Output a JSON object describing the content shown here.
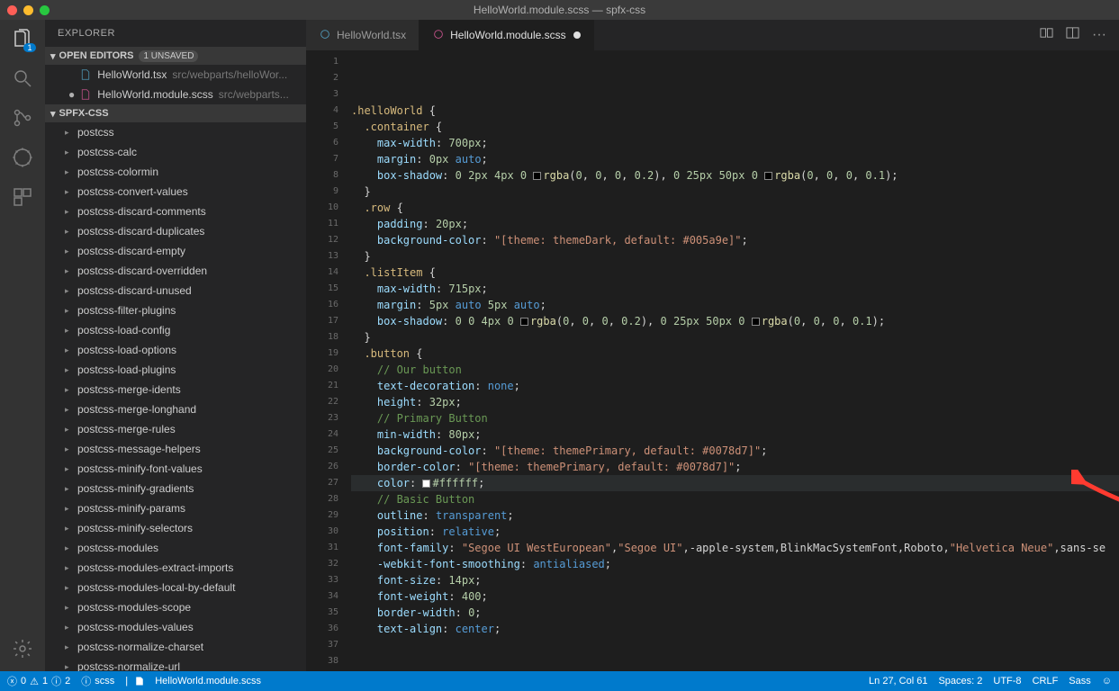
{
  "titlebar": {
    "title": "HelloWorld.module.scss — spfx-css"
  },
  "activity": {
    "badge": "1"
  },
  "sidebar": {
    "header": "EXPLORER",
    "open_editors": {
      "label": "OPEN EDITORS",
      "unsaved": "1 UNSAVED"
    },
    "files": [
      {
        "name": "HelloWorld.tsx",
        "path": "src/webparts/helloWor..."
      },
      {
        "name": "HelloWorld.module.scss",
        "path": "src/webparts..."
      }
    ],
    "project": "SPFX-CSS",
    "tree": [
      "postcss",
      "postcss-calc",
      "postcss-colormin",
      "postcss-convert-values",
      "postcss-discard-comments",
      "postcss-discard-duplicates",
      "postcss-discard-empty",
      "postcss-discard-overridden",
      "postcss-discard-unused",
      "postcss-filter-plugins",
      "postcss-load-config",
      "postcss-load-options",
      "postcss-load-plugins",
      "postcss-merge-idents",
      "postcss-merge-longhand",
      "postcss-merge-rules",
      "postcss-message-helpers",
      "postcss-minify-font-values",
      "postcss-minify-gradients",
      "postcss-minify-params",
      "postcss-minify-selectors",
      "postcss-modules",
      "postcss-modules-extract-imports",
      "postcss-modules-local-by-default",
      "postcss-modules-scope",
      "postcss-modules-values",
      "postcss-normalize-charset",
      "postcss-normalize-url"
    ]
  },
  "tabs": [
    {
      "name": "HelloWorld.tsx",
      "modified": false
    },
    {
      "name": "HelloWorld.module.scss",
      "modified": true
    }
  ],
  "status": {
    "errors": "0",
    "warnings_a": "1",
    "warnings_i": "2",
    "lang_status": "scss",
    "filename": "HelloWorld.module.scss",
    "pos": "Ln 27, Col 61",
    "spaces": "Spaces: 2",
    "enc": "UTF-8",
    "eol": "CRLF",
    "lang": "Sass"
  },
  "code": {
    "lines": [
      [
        {
          "c": "t-sel",
          "t": ".helloWorld"
        },
        {
          "t": " {"
        }
      ],
      [
        {
          "t": "  "
        },
        {
          "c": "t-sel",
          "t": ".container"
        },
        {
          "t": " {"
        }
      ],
      [
        {
          "t": "    "
        },
        {
          "c": "t-prop",
          "t": "max-width"
        },
        {
          "t": ": "
        },
        {
          "c": "t-num",
          "t": "700px"
        },
        {
          "t": ";"
        }
      ],
      [
        {
          "t": "    "
        },
        {
          "c": "t-prop",
          "t": "margin"
        },
        {
          "t": ": "
        },
        {
          "c": "t-num",
          "t": "0px"
        },
        {
          "t": " "
        },
        {
          "c": "t-key",
          "t": "auto"
        },
        {
          "t": ";"
        }
      ],
      [
        {
          "t": "    "
        },
        {
          "c": "t-prop",
          "t": "box-shadow"
        },
        {
          "t": ": "
        },
        {
          "c": "t-num",
          "t": "0"
        },
        {
          "t": " "
        },
        {
          "c": "t-num",
          "t": "2px"
        },
        {
          "t": " "
        },
        {
          "c": "t-num",
          "t": "4px"
        },
        {
          "t": " "
        },
        {
          "c": "t-num",
          "t": "0"
        },
        {
          "t": " "
        },
        {
          "box": "#000"
        },
        {
          "c": "t-fn",
          "t": "rgba"
        },
        {
          "t": "("
        },
        {
          "c": "t-num",
          "t": "0"
        },
        {
          "t": ", "
        },
        {
          "c": "t-num",
          "t": "0"
        },
        {
          "t": ", "
        },
        {
          "c": "t-num",
          "t": "0"
        },
        {
          "t": ", "
        },
        {
          "c": "t-num",
          "t": "0.2"
        },
        {
          "t": "), "
        },
        {
          "c": "t-num",
          "t": "0"
        },
        {
          "t": " "
        },
        {
          "c": "t-num",
          "t": "25px"
        },
        {
          "t": " "
        },
        {
          "c": "t-num",
          "t": "50px"
        },
        {
          "t": " "
        },
        {
          "c": "t-num",
          "t": "0"
        },
        {
          "t": " "
        },
        {
          "box": "#000"
        },
        {
          "c": "t-fn",
          "t": "rgba"
        },
        {
          "t": "("
        },
        {
          "c": "t-num",
          "t": "0"
        },
        {
          "t": ", "
        },
        {
          "c": "t-num",
          "t": "0"
        },
        {
          "t": ", "
        },
        {
          "c": "t-num",
          "t": "0"
        },
        {
          "t": ", "
        },
        {
          "c": "t-num",
          "t": "0.1"
        },
        {
          "t": ");"
        }
      ],
      [
        {
          "t": "  }"
        }
      ],
      [
        {
          "t": ""
        }
      ],
      [
        {
          "t": "  "
        },
        {
          "c": "t-sel",
          "t": ".row"
        },
        {
          "t": " {"
        }
      ],
      [
        {
          "t": "    "
        },
        {
          "c": "t-prop",
          "t": "padding"
        },
        {
          "t": ": "
        },
        {
          "c": "t-num",
          "t": "20px"
        },
        {
          "t": ";"
        }
      ],
      [
        {
          "t": "    "
        },
        {
          "c": "t-prop",
          "t": "background-color"
        },
        {
          "t": ": "
        },
        {
          "c": "t-str",
          "t": "\"[theme: themeDark, default: #005a9e]\""
        },
        {
          "t": ";"
        }
      ],
      [
        {
          "t": "  }"
        }
      ],
      [
        {
          "t": ""
        }
      ],
      [
        {
          "t": "  "
        },
        {
          "c": "t-sel",
          "t": ".listItem"
        },
        {
          "t": " {"
        }
      ],
      [
        {
          "t": "    "
        },
        {
          "c": "t-prop",
          "t": "max-width"
        },
        {
          "t": ": "
        },
        {
          "c": "t-num",
          "t": "715px"
        },
        {
          "t": ";"
        }
      ],
      [
        {
          "t": "    "
        },
        {
          "c": "t-prop",
          "t": "margin"
        },
        {
          "t": ": "
        },
        {
          "c": "t-num",
          "t": "5px"
        },
        {
          "t": " "
        },
        {
          "c": "t-key",
          "t": "auto"
        },
        {
          "t": " "
        },
        {
          "c": "t-num",
          "t": "5px"
        },
        {
          "t": " "
        },
        {
          "c": "t-key",
          "t": "auto"
        },
        {
          "t": ";"
        }
      ],
      [
        {
          "t": "    "
        },
        {
          "c": "t-prop",
          "t": "box-shadow"
        },
        {
          "t": ": "
        },
        {
          "c": "t-num",
          "t": "0"
        },
        {
          "t": " "
        },
        {
          "c": "t-num",
          "t": "0"
        },
        {
          "t": " "
        },
        {
          "c": "t-num",
          "t": "4px"
        },
        {
          "t": " "
        },
        {
          "c": "t-num",
          "t": "0"
        },
        {
          "t": " "
        },
        {
          "box": "#000"
        },
        {
          "c": "t-fn",
          "t": "rgba"
        },
        {
          "t": "("
        },
        {
          "c": "t-num",
          "t": "0"
        },
        {
          "t": ", "
        },
        {
          "c": "t-num",
          "t": "0"
        },
        {
          "t": ", "
        },
        {
          "c": "t-num",
          "t": "0"
        },
        {
          "t": ", "
        },
        {
          "c": "t-num",
          "t": "0.2"
        },
        {
          "t": "), "
        },
        {
          "c": "t-num",
          "t": "0"
        },
        {
          "t": " "
        },
        {
          "c": "t-num",
          "t": "25px"
        },
        {
          "t": " "
        },
        {
          "c": "t-num",
          "t": "50px"
        },
        {
          "t": " "
        },
        {
          "c": "t-num",
          "t": "0"
        },
        {
          "t": " "
        },
        {
          "box": "#000"
        },
        {
          "c": "t-fn",
          "t": "rgba"
        },
        {
          "t": "("
        },
        {
          "c": "t-num",
          "t": "0"
        },
        {
          "t": ", "
        },
        {
          "c": "t-num",
          "t": "0"
        },
        {
          "t": ", "
        },
        {
          "c": "t-num",
          "t": "0"
        },
        {
          "t": ", "
        },
        {
          "c": "t-num",
          "t": "0.1"
        },
        {
          "t": ");"
        }
      ],
      [
        {
          "t": "  }"
        }
      ],
      [
        {
          "t": ""
        }
      ],
      [
        {
          "t": "  "
        },
        {
          "c": "t-sel",
          "t": ".button"
        },
        {
          "t": " {"
        }
      ],
      [
        {
          "t": "    "
        },
        {
          "c": "t-cmt",
          "t": "// Our button"
        }
      ],
      [
        {
          "t": "    "
        },
        {
          "c": "t-prop",
          "t": "text-decoration"
        },
        {
          "t": ": "
        },
        {
          "c": "t-key",
          "t": "none"
        },
        {
          "t": ";"
        }
      ],
      [
        {
          "t": "    "
        },
        {
          "c": "t-prop",
          "t": "height"
        },
        {
          "t": ": "
        },
        {
          "c": "t-num",
          "t": "32px"
        },
        {
          "t": ";"
        }
      ],
      [
        {
          "t": ""
        }
      ],
      [
        {
          "t": "    "
        },
        {
          "c": "t-cmt",
          "t": "// Primary Button"
        }
      ],
      [
        {
          "t": "    "
        },
        {
          "c": "t-prop",
          "t": "min-width"
        },
        {
          "t": ": "
        },
        {
          "c": "t-num",
          "t": "80px"
        },
        {
          "t": ";"
        }
      ],
      [
        {
          "t": "    "
        },
        {
          "c": "t-prop",
          "t": "background-color"
        },
        {
          "t": ": "
        },
        {
          "c": "t-str",
          "t": "\"[theme: themePrimary, default: #0078d7]\""
        },
        {
          "t": ";"
        }
      ],
      [
        {
          "t": "    "
        },
        {
          "c": "t-prop",
          "t": "border-color"
        },
        {
          "t": ": "
        },
        {
          "c": "t-str",
          "t": "\"[theme: themePrimary, default: #0078d7]\""
        },
        {
          "t": ";"
        }
      ],
      [
        {
          "t": "    "
        },
        {
          "c": "t-prop",
          "t": "color"
        },
        {
          "t": ": "
        },
        {
          "box": "#ffffff"
        },
        {
          "c": "t-num",
          "t": "#ffffff"
        },
        {
          "t": ";"
        }
      ],
      [
        {
          "t": ""
        }
      ],
      [
        {
          "t": "    "
        },
        {
          "c": "t-cmt",
          "t": "// Basic Button"
        }
      ],
      [
        {
          "t": "    "
        },
        {
          "c": "t-prop",
          "t": "outline"
        },
        {
          "t": ": "
        },
        {
          "c": "t-key",
          "t": "transparent"
        },
        {
          "t": ";"
        }
      ],
      [
        {
          "t": "    "
        },
        {
          "c": "t-prop",
          "t": "position"
        },
        {
          "t": ": "
        },
        {
          "c": "t-key",
          "t": "relative"
        },
        {
          "t": ";"
        }
      ],
      [
        {
          "t": "    "
        },
        {
          "c": "t-prop",
          "t": "font-family"
        },
        {
          "t": ": "
        },
        {
          "c": "t-str",
          "t": "\"Segoe UI WestEuropean\""
        },
        {
          "t": ","
        },
        {
          "c": "t-str",
          "t": "\"Segoe UI\""
        },
        {
          "t": ",-apple-system,BlinkMacSystemFont,Roboto,"
        },
        {
          "c": "t-str",
          "t": "\"Helvetica Neue\""
        },
        {
          "t": ",sans-se"
        }
      ],
      [
        {
          "t": "    "
        },
        {
          "c": "t-prop",
          "t": "-webkit-font-smoothing"
        },
        {
          "t": ": "
        },
        {
          "c": "t-key",
          "t": "antialiased"
        },
        {
          "t": ";"
        }
      ],
      [
        {
          "t": "    "
        },
        {
          "c": "t-prop",
          "t": "font-size"
        },
        {
          "t": ": "
        },
        {
          "c": "t-num",
          "t": "14px"
        },
        {
          "t": ";"
        }
      ],
      [
        {
          "t": "    "
        },
        {
          "c": "t-prop",
          "t": "font-weight"
        },
        {
          "t": ": "
        },
        {
          "c": "t-num",
          "t": "400"
        },
        {
          "t": ";"
        }
      ],
      [
        {
          "t": "    "
        },
        {
          "c": "t-prop",
          "t": "border-width"
        },
        {
          "t": ": "
        },
        {
          "c": "t-num",
          "t": "0"
        },
        {
          "t": ";"
        }
      ],
      [
        {
          "t": "    "
        },
        {
          "c": "t-prop",
          "t": "text-align"
        },
        {
          "t": ": "
        },
        {
          "c": "t-key",
          "t": "center"
        },
        {
          "t": ";"
        }
      ],
      [
        {
          "t": ""
        }
      ]
    ]
  }
}
